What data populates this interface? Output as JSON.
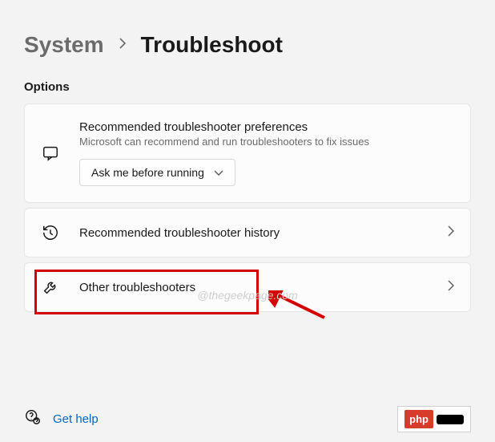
{
  "breadcrumb": {
    "parent": "System",
    "current": "Troubleshoot"
  },
  "section_label": "Options",
  "card_pref": {
    "title": "Recommended troubleshooter preferences",
    "subtitle": "Microsoft can recommend and run troubleshooters to fix issues",
    "dropdown_value": "Ask me before running"
  },
  "card_history": {
    "title": "Recommended troubleshooter history"
  },
  "card_other": {
    "title": "Other troubleshooters"
  },
  "watermark": "@thegeekpage.com",
  "help": {
    "label": "Get help"
  },
  "badge": {
    "text": "php"
  }
}
